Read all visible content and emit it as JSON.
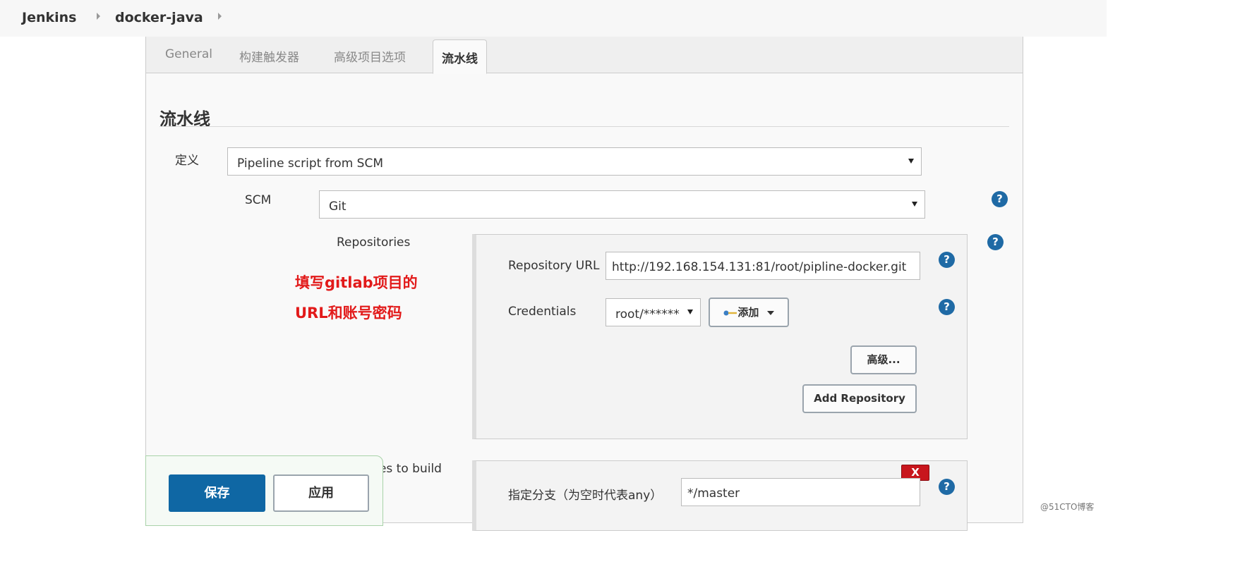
{
  "breadcrumb": {
    "items": [
      "Jenkins",
      "docker-java"
    ]
  },
  "tabs": [
    {
      "label": "General",
      "active": false
    },
    {
      "label": "构建触发器",
      "active": false
    },
    {
      "label": "高级项目选项",
      "active": false
    },
    {
      "label": "流水线",
      "active": true
    }
  ],
  "section": {
    "title": "流水线"
  },
  "definition": {
    "label": "定义",
    "value": "Pipeline script from SCM"
  },
  "scm": {
    "label": "SCM",
    "value": "Git"
  },
  "repositories": {
    "label": "Repositories",
    "url_label": "Repository URL",
    "url_value": "http://192.168.154.131:81/root/pipline-docker.git",
    "credentials_label": "Credentials",
    "credentials_value": "root/******",
    "add_button": "添加",
    "advanced_button": "高级...",
    "add_repository_button": "Add Repository"
  },
  "annotation": {
    "line1": "填写gitlab项目的",
    "line2": "URL和账号密码"
  },
  "branches": {
    "label": "Branches to build",
    "delete_label": "X",
    "branch_label": "指定分支（为空时代表any）",
    "branch_value": "*/master"
  },
  "actions": {
    "save": "保存",
    "apply": "应用"
  },
  "help_glyph": "?",
  "watermark": "@51CTO博客",
  "colors": {
    "primary": "#0f67a4",
    "help": "#1f6aa5",
    "danger": "#c8161d",
    "annotation": "#e21a1a"
  }
}
